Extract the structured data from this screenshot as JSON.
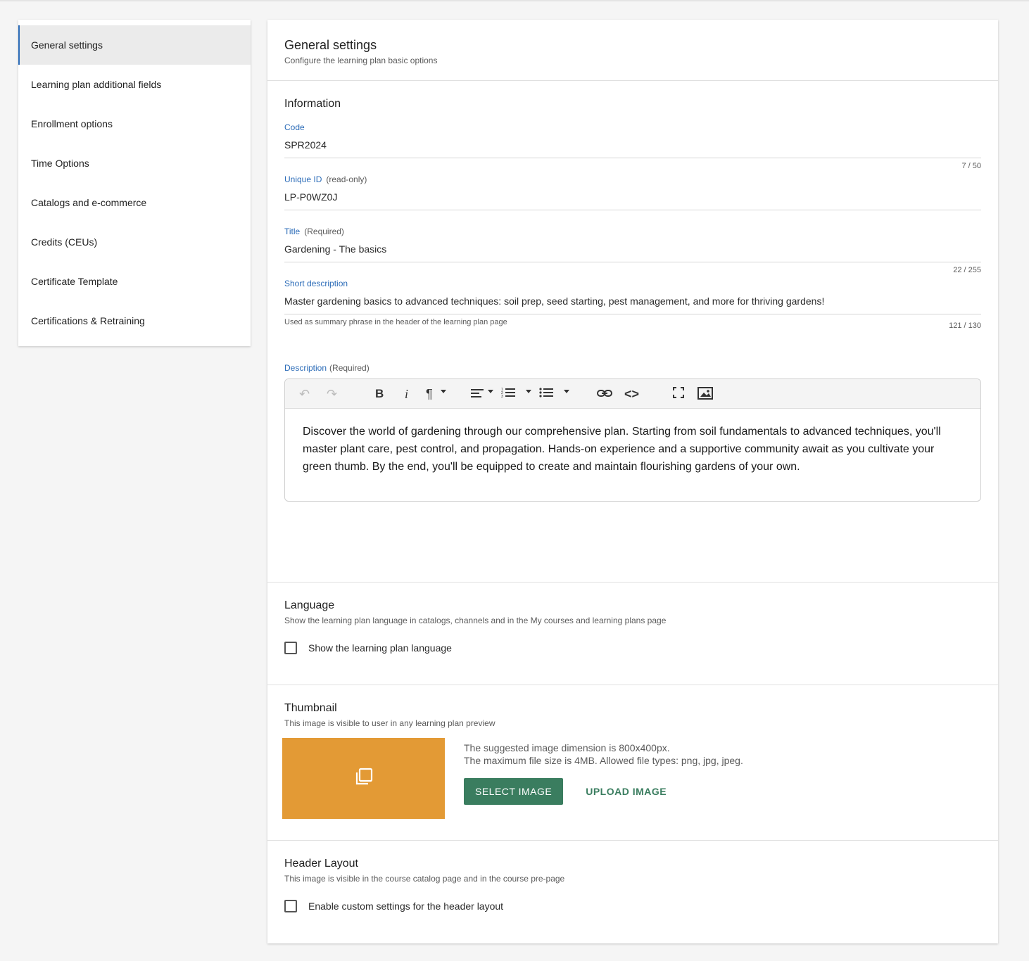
{
  "sidebar": {
    "items": [
      {
        "label": "General settings"
      },
      {
        "label": "Learning plan additional fields"
      },
      {
        "label": "Enrollment options"
      },
      {
        "label": "Time Options"
      },
      {
        "label": "Catalogs and e-commerce"
      },
      {
        "label": "Credits (CEUs)"
      },
      {
        "label": "Certificate Template"
      },
      {
        "label": "Certifications & Retraining"
      }
    ]
  },
  "header": {
    "title": "General settings",
    "subtitle": "Configure the learning plan basic options"
  },
  "information": {
    "title": "Information",
    "code": {
      "label": "Code",
      "value": "SPR2024",
      "count": "7 / 50"
    },
    "unique_id": {
      "label": "Unique ID",
      "note": "(read-only)",
      "value": "LP-P0WZ0J"
    },
    "title_field": {
      "label": "Title",
      "note": "(Required)",
      "value": "Gardening - The basics",
      "count": "22 / 255"
    },
    "short_description": {
      "label": "Short description",
      "value": "Master gardening basics to advanced techniques: soil prep, seed starting, pest management, and more for thriving gardens!",
      "hint": "Used as summary phrase in the header of the learning plan page",
      "count": "121 / 130"
    },
    "description": {
      "label": "Description",
      "note": "(Required)",
      "value": "Discover the world of gardening through our comprehensive plan. Starting from soil fundamentals to advanced techniques, you'll master plant care, pest control, and propagation. Hands-on experience and a supportive community await as you cultivate your green thumb. By the end, you'll be equipped to create and maintain flourishing gardens of your own."
    }
  },
  "toolbar": {
    "icons": [
      "undo-icon",
      "redo-icon",
      "bold-icon",
      "italic-icon",
      "paragraph-icon",
      "align-icon",
      "ordered-list-icon",
      "unordered-list-icon",
      "link-icon",
      "code-icon",
      "fullscreen-icon",
      "image-icon"
    ]
  },
  "language": {
    "title": "Language",
    "desc": "Show the learning plan language in catalogs, channels and in the My courses and learning plans page",
    "checkbox_label": "Show the learning plan language",
    "checked": false
  },
  "thumbnail": {
    "title": "Thumbnail",
    "desc": "This image is visible to user in any learning plan preview",
    "info_line1": "The suggested image dimension is 800x400px.",
    "info_line2": "The maximum file size is 4MB. Allowed file types: png, jpg, jpeg.",
    "select_button": "SELECT IMAGE",
    "upload_button": "UPLOAD IMAGE",
    "placeholder_color": "#e39a35"
  },
  "header_layout": {
    "title": "Header Layout",
    "desc": "This image is visible in the course catalog page and in the course pre-page",
    "checkbox_label": "Enable custom settings for the header layout",
    "checked": false
  },
  "colors": {
    "accent_blue": "#2c6cb8",
    "primary_green": "#3a7d5f"
  }
}
